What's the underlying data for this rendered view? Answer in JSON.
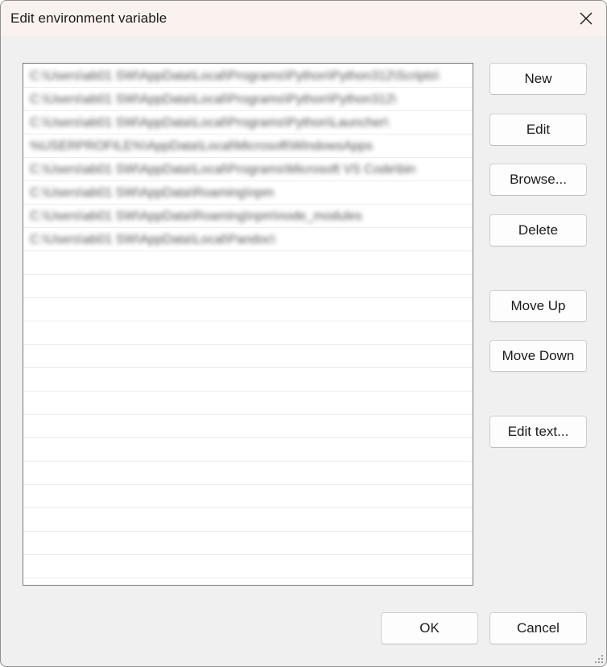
{
  "window": {
    "title": "Edit environment variable"
  },
  "path_list": {
    "entries": [
      "C:\\Users\\ab01 SW\\AppData\\Local\\Programs\\Python\\Python312\\Scripts\\",
      "C:\\Users\\ab01 SW\\AppData\\Local\\Programs\\Python\\Python312\\",
      "C:\\Users\\ab01 SW\\AppData\\Local\\Programs\\Python\\Launcher\\",
      "%USERPROFILE%\\AppData\\Local\\Microsoft\\WindowsApps",
      "C:\\Users\\ab01 SW\\AppData\\Local\\Programs\\Microsoft VS Code\\bin",
      "C:\\Users\\ab01 SW\\AppData\\Roaming\\npm",
      "C:\\Users\\ab01 SW\\AppData\\Roaming\\npm\\node_modules",
      "C:\\Users\\ab01 SW\\AppData\\Local\\Pandoc\\"
    ]
  },
  "buttons": {
    "new": "New",
    "edit": "Edit",
    "browse": "Browse...",
    "delete": "Delete",
    "move_up": "Move Up",
    "move_down": "Move Down",
    "edit_text": "Edit text...",
    "ok": "OK",
    "cancel": "Cancel"
  },
  "icons": {
    "close": "close-icon",
    "resize": "resize-grip-icon"
  }
}
